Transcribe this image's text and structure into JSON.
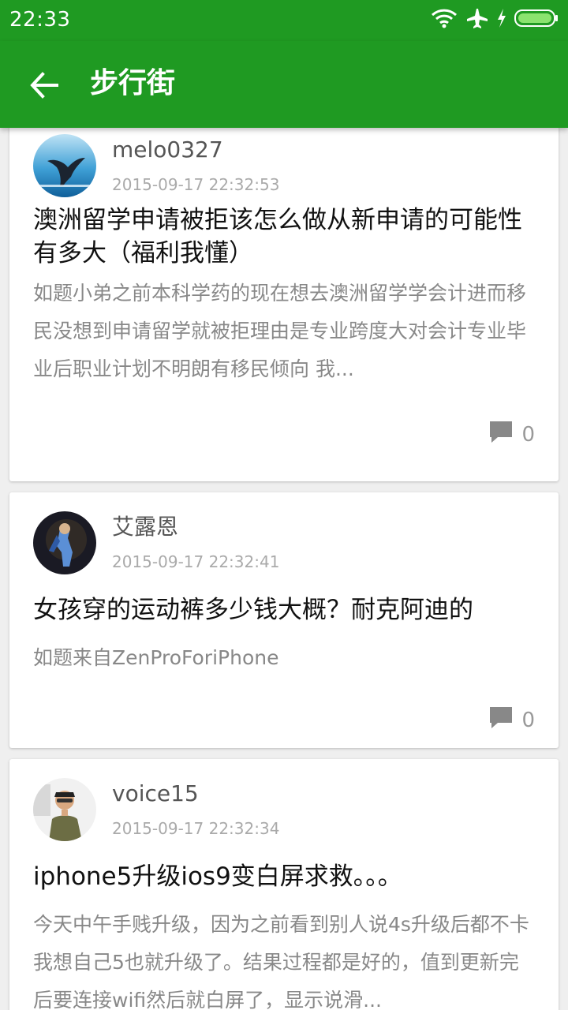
{
  "status_bar": {
    "time": "22:33",
    "icons": [
      "wifi-icon",
      "airplane-mode-icon",
      "charging-icon",
      "battery-icon"
    ]
  },
  "app_bar": {
    "title": "步行街",
    "back_icon": "back-arrow-icon"
  },
  "colors": {
    "primary": "#1f9a22",
    "background": "#efefef",
    "card": "#ffffff",
    "title_text": "#111111",
    "body_text": "#888888",
    "meta_text": "#aaaaaa"
  },
  "posts": [
    {
      "username": "melo0327",
      "timestamp": "2015-09-17 22:32:53",
      "title": "澳洲留学申请被拒该怎么做从新申请的可能性有多大（福利我懂）",
      "body": "如题小弟之前本科学药的现在想去澳洲留学学会计进而移民没想到申请留学就被拒理由是专业跨度大对会计专业毕业后职业计划不明朗有移民倾向 我...",
      "comment_count": "0",
      "avatar_icon": "whale-avatar"
    },
    {
      "username": "艾露恩",
      "timestamp": "2015-09-17 22:32:41",
      "title": "女孩穿的运动裤多少钱大概？耐克阿迪的",
      "body": "如题来自ZenProForiPhone",
      "comment_count": "0",
      "avatar_icon": "fantasy-character-avatar"
    },
    {
      "username": "voice15",
      "timestamp": "2015-09-17 22:32:34",
      "title": "iphone5升级ios9变白屏求救。。。",
      "body": "今天中午手贱升级，因为之前看到别人说4s升级后都不卡我想自己5也就升级了。结果过程都是好的，值到更新完后要连接wifi然后就白屏了，显示说滑...",
      "comment_count": "",
      "avatar_icon": "person-avatar"
    }
  ]
}
